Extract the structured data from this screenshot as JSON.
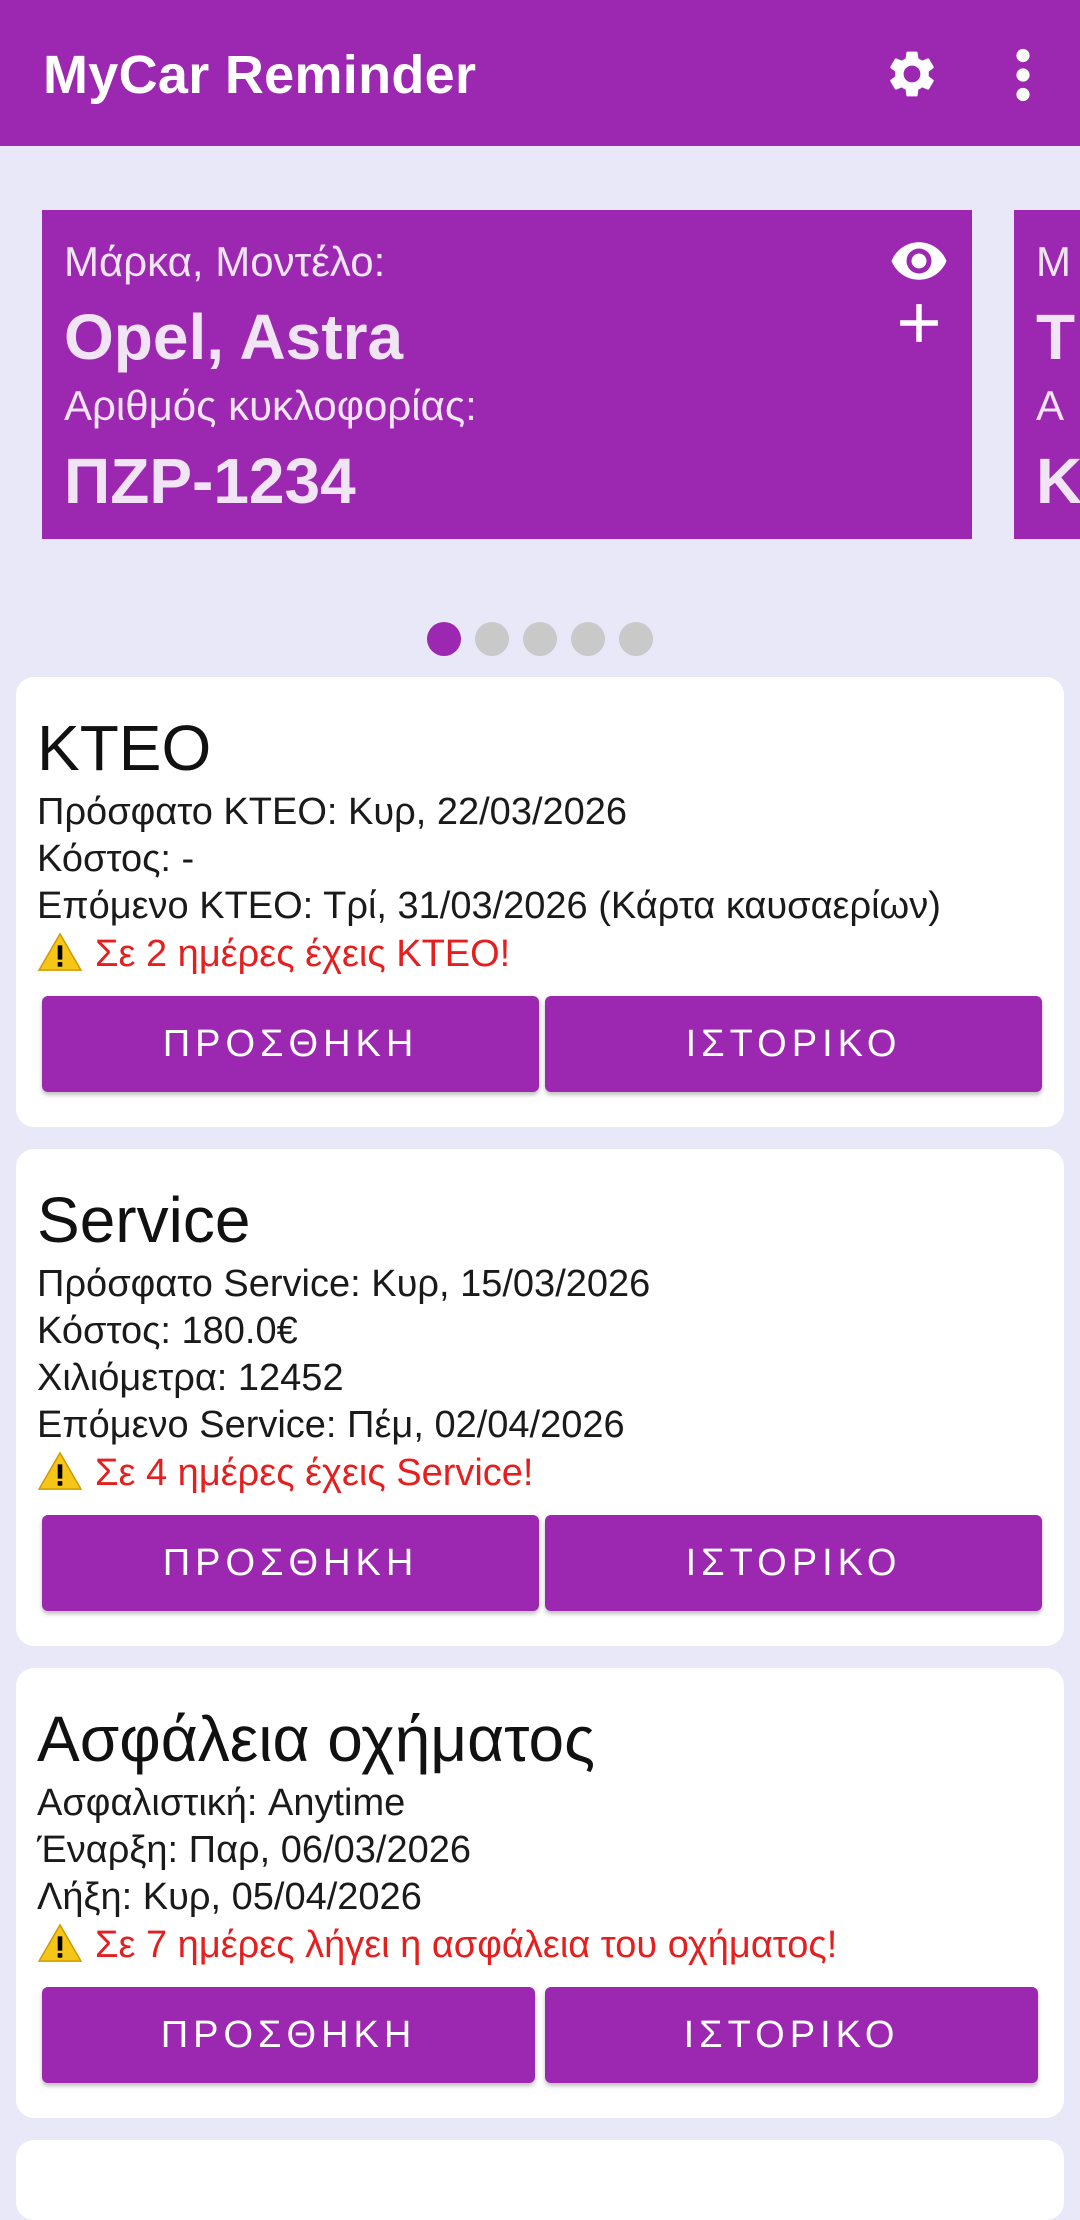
{
  "app": {
    "title": "MyCar Reminder",
    "accent_color": "#9c27b0",
    "settings_icon": "gear-icon",
    "menu_icon": "more-vert-icon"
  },
  "car": {
    "make_model_label": "Μάρκα, Μοντέλο:",
    "make_model": "Opel, Astra",
    "plate_label": "Αριθμός κυκλοφορίας:",
    "plate": "ΠΖΡ-1234",
    "view_icon": "eye-icon",
    "add_icon": "plus-icon"
  },
  "car_next": {
    "make_model_label": "Μ",
    "make_model": "T",
    "plate_label": "Α",
    "plate": "K"
  },
  "pager": {
    "count": 5,
    "active_index": 0
  },
  "sections": {
    "kteo": {
      "title": "ΚΤΕΟ",
      "recent": "Πρόσφατο ΚΤΕΟ: Κυρ, 22/03/2026",
      "cost": "Κόστος: -",
      "next": "Επόμενο ΚΤΕΟ: Τρί, 31/03/2026 (Κάρτα καυσαερίων)",
      "warning": "Σε 2 ημέρες έχεις ΚΤΕΟ!",
      "add_label": "ΠΡΟΣΘΗΚΗ",
      "history_label": "ΙΣΤΟΡΙΚΟ"
    },
    "service": {
      "title": "Service",
      "recent": "Πρόσφατο Service: Κυρ, 15/03/2026",
      "cost": "Κόστος: 180.0€",
      "km": "Χιλιόμετρα: 12452",
      "next": "Επόμενο Service: Πέμ, 02/04/2026",
      "warning": "Σε 4 ημέρες έχεις Service!",
      "add_label": "ΠΡΟΣΘΗΚΗ",
      "history_label": "ΙΣΤΟΡΙΚΟ"
    },
    "insurance": {
      "title": "Ασφάλεια οχήματος",
      "insurer": "Ασφαλιστική: Anytime",
      "start": "Έναρξη: Παρ, 06/03/2026",
      "end": "Λήξη: Κυρ, 05/04/2026",
      "warning": "Σε 7 ημέρες λήγει η ασφάλεια του οχήματος!",
      "add_label": "ΠΡΟΣΘΗΚΗ",
      "history_label": "ΙΣΤΟΡΙΚΟ"
    }
  },
  "warning_icon": "warning-icon",
  "warning_color": "#e61e1e"
}
